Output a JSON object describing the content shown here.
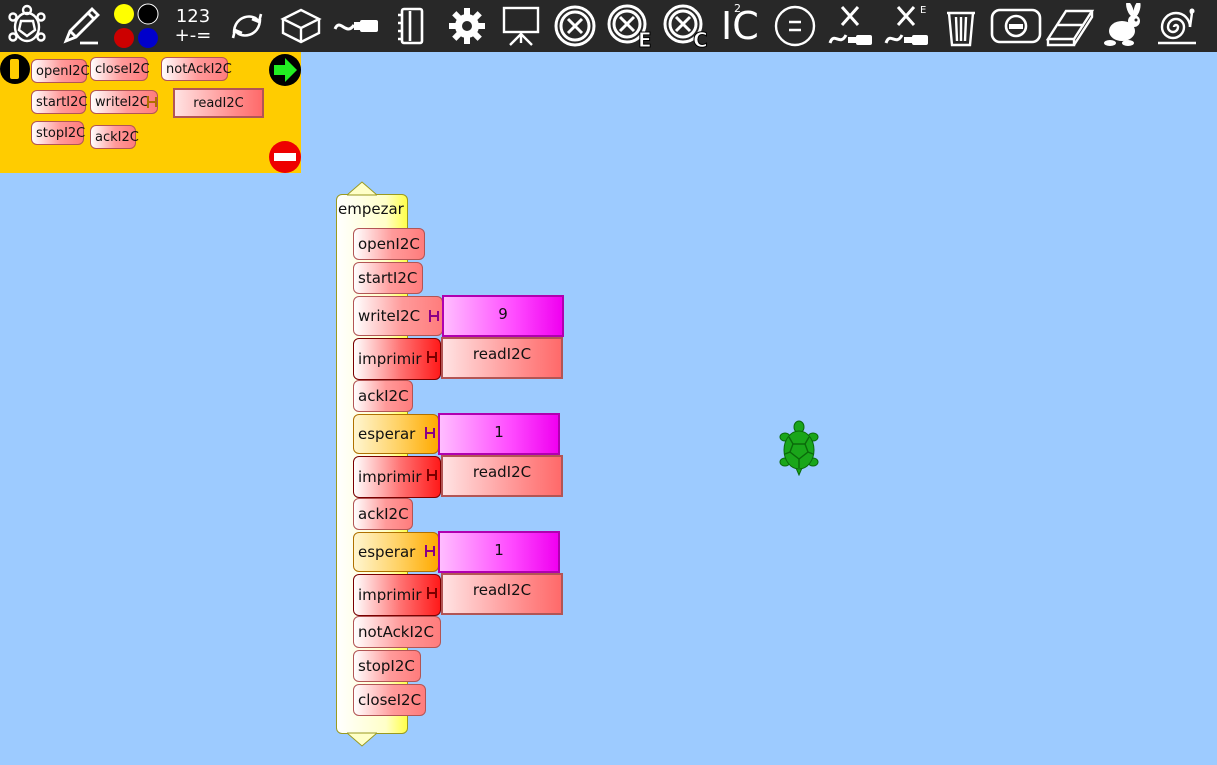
{
  "toolbar": {
    "items": [
      {
        "icon": "turtle-logo-icon",
        "interactable": false
      },
      {
        "icon": "pen-icon"
      },
      {
        "icon": "color-palette-icon"
      },
      {
        "icon": "number-operators-icon",
        "label_top": "123",
        "label_bottom": "+-="
      },
      {
        "icon": "flow-icon"
      },
      {
        "icon": "boxes-icon"
      },
      {
        "icon": "actions-icon"
      },
      {
        "icon": "sensors-icon"
      },
      {
        "icon": "extras-icon"
      },
      {
        "icon": "presentation-icon"
      },
      {
        "icon": "stop-all-icon"
      },
      {
        "icon": "stop-e-icon"
      },
      {
        "icon": "stop-c-icon"
      },
      {
        "icon": "i2c-palette-icon",
        "label": "IC",
        "superscript": "2"
      },
      {
        "icon": "equals-circle-icon"
      },
      {
        "icon": "clear-variables-icon"
      },
      {
        "icon": "clear-extras-icon",
        "superscript": "E"
      },
      {
        "icon": "trash-icon"
      },
      {
        "icon": "hide-blocks-icon"
      },
      {
        "icon": "eraser-icon"
      },
      {
        "icon": "run-fast-icon"
      },
      {
        "icon": "run-slow-icon"
      }
    ],
    "colors": {
      "yellow": "#ffff00",
      "black": "#000000",
      "red": "#cc0000",
      "blue": "#0000cc"
    }
  },
  "palette": {
    "background": "#ffcc00",
    "blocks": [
      {
        "name": "openI2C",
        "label": "openI2C"
      },
      {
        "name": "closeI2C",
        "label": "closeI2C"
      },
      {
        "name": "notAckI2C",
        "label": "notAckI2C"
      },
      {
        "name": "startI2C",
        "label": "startI2C"
      },
      {
        "name": "writeI2C",
        "label": "writeI2C"
      },
      {
        "name": "readI2C",
        "label": "readI2C"
      },
      {
        "name": "stopI2C",
        "label": "stopI2C"
      },
      {
        "name": "ackI2C",
        "label": "ackI2C"
      }
    ]
  },
  "program": {
    "start_label": "empezar",
    "blocks": [
      {
        "label": "openI2C",
        "kind": "pink"
      },
      {
        "label": "startI2C",
        "kind": "pink"
      },
      {
        "label": "writeI2C",
        "kind": "pink",
        "arg": {
          "type": "number",
          "value": "9"
        }
      },
      {
        "label": "imprimir",
        "kind": "red",
        "arg": {
          "type": "block",
          "value": "readI2C"
        }
      },
      {
        "label": "ackI2C",
        "kind": "pink"
      },
      {
        "label": "esperar",
        "kind": "orange",
        "arg": {
          "type": "number",
          "value": "1"
        }
      },
      {
        "label": "imprimir",
        "kind": "red",
        "arg": {
          "type": "block",
          "value": "readI2C"
        }
      },
      {
        "label": "ackI2C",
        "kind": "pink"
      },
      {
        "label": "esperar",
        "kind": "orange",
        "arg": {
          "type": "number",
          "value": "1"
        }
      },
      {
        "label": "imprimir",
        "kind": "red",
        "arg": {
          "type": "block",
          "value": "readI2C"
        }
      },
      {
        "label": "notAckI2C",
        "kind": "pink"
      },
      {
        "label": "stopI2C",
        "kind": "pink"
      },
      {
        "label": "closeI2C",
        "kind": "pink"
      }
    ]
  },
  "canvas": {
    "background": "#9dcbff",
    "turtle_icon": "turtle-icon"
  }
}
